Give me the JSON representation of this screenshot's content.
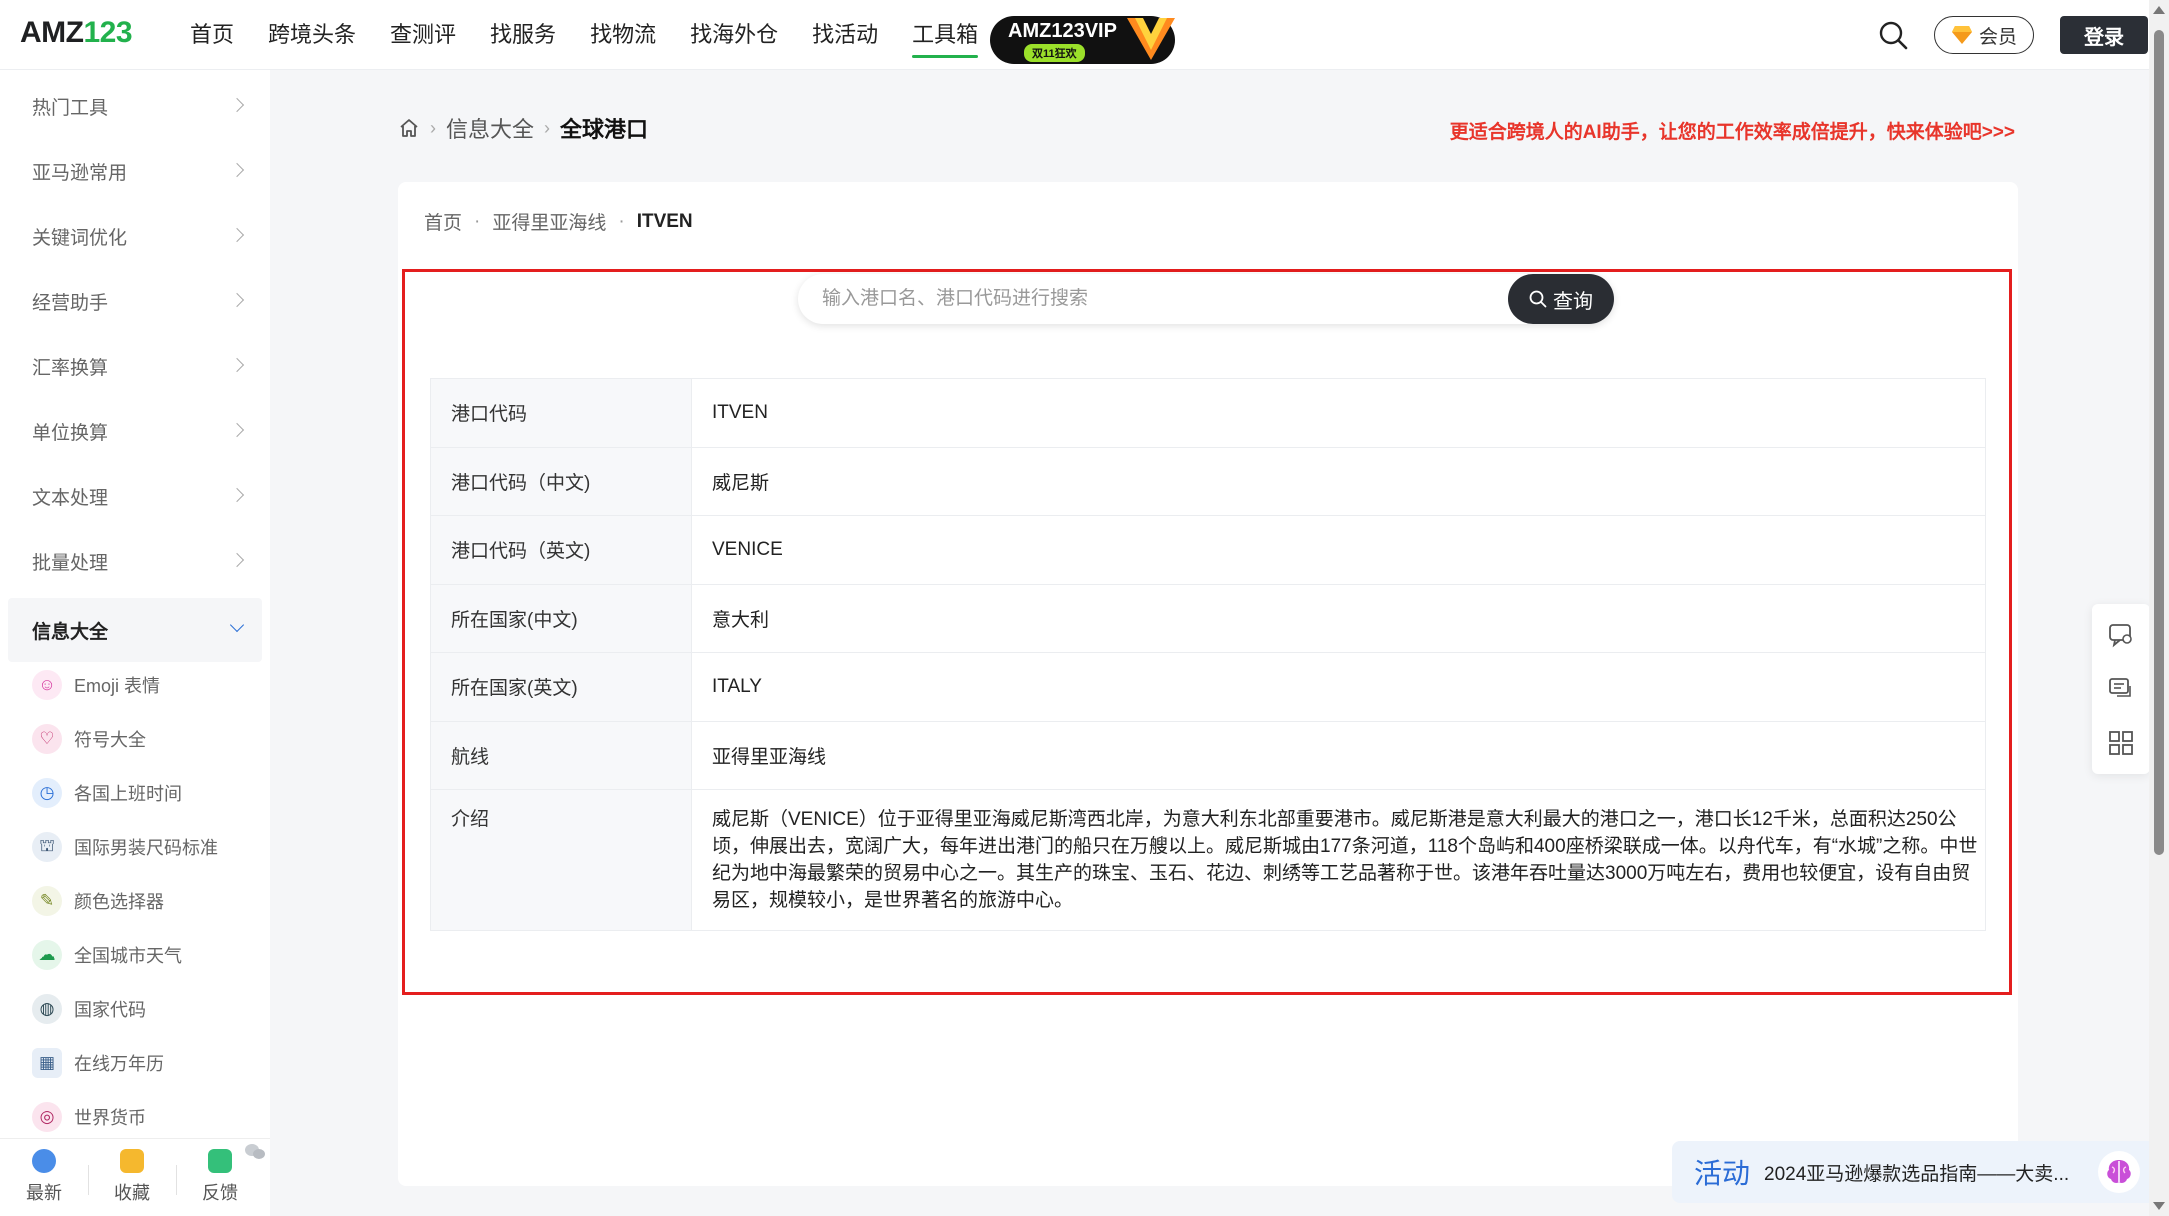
{
  "logo": {
    "part1": "AMZ",
    "part2": "123"
  },
  "nav": {
    "items": [
      "首页",
      "跨境头条",
      "查测评",
      "找服务",
      "找物流",
      "找海外仓",
      "找活动",
      "工具箱"
    ],
    "active_index": 7,
    "vip_title": "AMZ123VIP",
    "vip_sub": "双11狂欢",
    "member_label": "会员",
    "login_label": "登录"
  },
  "sidebar": {
    "groups": [
      "热门工具",
      "亚马逊常用",
      "关键词优化",
      "经营助手",
      "汇率换算",
      "单位换算",
      "文本处理",
      "批量处理"
    ],
    "open_group": "信息大全",
    "sub_items": [
      {
        "label": "Emoji 表情",
        "icon": "smile-icon"
      },
      {
        "label": "符号大全",
        "icon": "heart-icon"
      },
      {
        "label": "各国上班时间",
        "icon": "clock-icon"
      },
      {
        "label": "国际男装尺码标准",
        "icon": "shirt-icon"
      },
      {
        "label": "颜色选择器",
        "icon": "palette-icon"
      },
      {
        "label": "全国城市天气",
        "icon": "weather-icon"
      },
      {
        "label": "国家代码",
        "icon": "globe-icon"
      },
      {
        "label": "在线万年历",
        "icon": "calendar-icon"
      },
      {
        "label": "世界货币",
        "icon": "currency-icon"
      }
    ],
    "bottom": {
      "latest": "最新",
      "favorite": "收藏",
      "feedback": "反馈"
    }
  },
  "breadcrumb_top": {
    "level1": "信息大全",
    "current": "全球港口"
  },
  "promo_text": "更适合跨境人的AI助手，让您的工作效率成倍提升，快来体验吧>>>",
  "breadcrumb_inner": {
    "home": "首页",
    "route": "亚得里亚海线",
    "current": "ITVEN"
  },
  "search": {
    "placeholder": "输入港口名、港口代码进行搜索",
    "button": "查询"
  },
  "port_info": [
    {
      "key": "港口代码",
      "value": "ITVEN"
    },
    {
      "key": "港口代码（中文)",
      "value": "威尼斯"
    },
    {
      "key": "港口代码（英文)",
      "value": "VENICE"
    },
    {
      "key": "所在国家(中文)",
      "value": "意大利"
    },
    {
      "key": "所在国家(英文)",
      "value": "ITALY"
    },
    {
      "key": "航线",
      "value": "亚得里亚海线"
    },
    {
      "key": "介绍",
      "value": "威尼斯（VENICE）位于亚得里亚海威尼斯湾西北岸，为意大利东北部重要港市。威尼斯港是意大利最大的港口之一，港口长12千米，总面积达250公顷，伸展出去，宽阔广大，每年进出港门的船只在万艘以上。威尼斯城由177条河道，118个岛屿和400座桥梁联成一体。以舟代车，有“水城”之称。中世纪为地中海最繁荣的贸易中心之一。其生产的珠宝、玉石、花边、刺绣等工艺品著称于世。该港年吞吐量达3000万吨左右，费用也较便宜，设有自由贸易区，规模较小，是世界著名的旅游中心。"
    }
  ],
  "activity": {
    "tag": "活动",
    "text": "2024亚马逊爆款选品指南——大卖..."
  },
  "colors": {
    "brand_green": "#22b14c",
    "promo_red": "#e8352b",
    "highlight_frame": "#e41e1e",
    "dark": "#2b2f36"
  }
}
